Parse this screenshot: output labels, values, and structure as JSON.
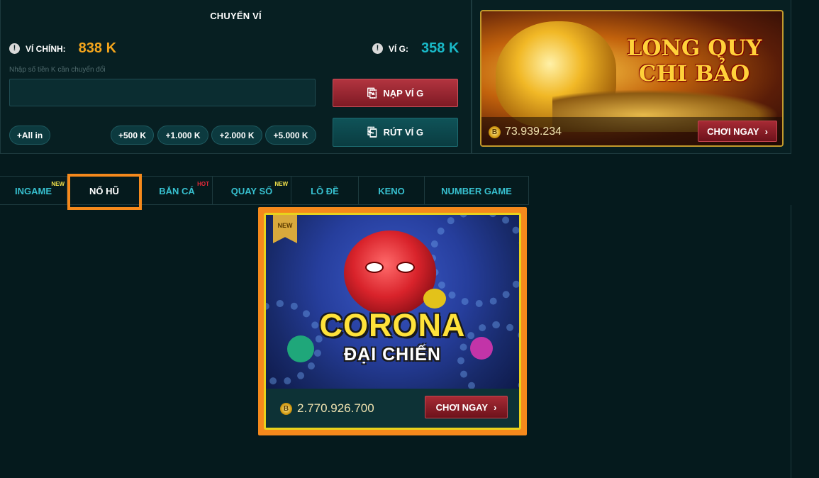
{
  "wallet": {
    "title": "CHUYỂN VÍ",
    "main_label": "VÍ CHÍNH:",
    "main_value": "838 K",
    "g_label": "VÍ G:",
    "g_value": "358 K",
    "input_placeholder": "Nhập số tiền K cần chuyển đổi",
    "deposit_label": "NẠP VÍ G",
    "withdraw_label": "RÚT VÍ G",
    "chips": [
      "+All in",
      "+500 K",
      "+1.000 K",
      "+2.000 K",
      "+5.000 K"
    ]
  },
  "feature": {
    "title_line1": "LONG QUY",
    "title_line2": "CHI BẢO",
    "jackpot": "73.939.234",
    "play_label": "CHƠI NGAY"
  },
  "tabs": [
    {
      "label": "INGAME",
      "tag": "NEW"
    },
    {
      "label": "NỔ HŨ",
      "tag": ""
    },
    {
      "label": "BẮN CÁ",
      "tag": "HOT"
    },
    {
      "label": "QUAY SỐ",
      "tag": "NEW"
    },
    {
      "label": "LÔ ĐỀ",
      "tag": ""
    },
    {
      "label": "KENO",
      "tag": ""
    },
    {
      "label": "NUMBER GAME",
      "tag": ""
    }
  ],
  "active_tab": "NỔ HŨ",
  "game": {
    "ribbon": "NEW",
    "title_line1": "CORONA",
    "title_line2": "ĐẠI CHIẾN",
    "jackpot": "2.770.926.700",
    "play_label": "CHƠI NGAY"
  },
  "icons": {
    "info": "info-icon",
    "wallet": "wallet-icon",
    "coin": "coin-icon",
    "chevron": "chevron-right-icon"
  },
  "colors": {
    "accent_orange": "#f5891c",
    "main_wallet_value": "#f4a51c",
    "g_wallet_value": "#19b9c8",
    "tab_text": "#37c0cf",
    "play_button": "#a62a34"
  }
}
